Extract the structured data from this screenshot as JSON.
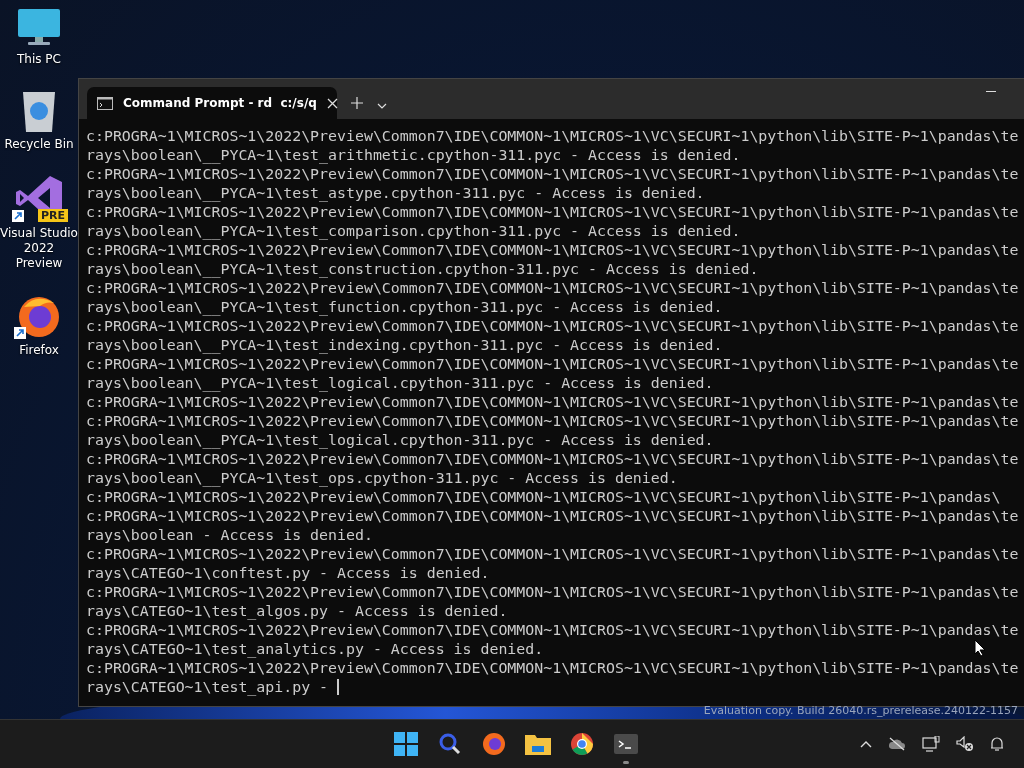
{
  "desktop_icons": [
    {
      "kind": "pc",
      "label": "This PC"
    },
    {
      "kind": "bin",
      "label": "Recycle Bin"
    },
    {
      "kind": "vs",
      "label": "Visual Studio 2022 Preview",
      "badge": "PRE",
      "shortcut": true
    },
    {
      "kind": "firefox",
      "label": "Firefox",
      "shortcut": true
    }
  ],
  "window": {
    "tabs": [
      {
        "title": "Command Prompt - rd  c:/s/q",
        "selected": true
      }
    ],
    "lines": [
      "c:PROGRA~1\\MICROS~1\\2022\\Preview\\Common7\\IDE\\COMMON~1\\MICROS~1\\VC\\SECURI~1\\python\\lib\\SITE-P~1\\pandas\\te",
      "rays\\boolean\\__PYCA~1\\test_arithmetic.cpython-311.pyc - Access is denied.",
      "c:PROGRA~1\\MICROS~1\\2022\\Preview\\Common7\\IDE\\COMMON~1\\MICROS~1\\VC\\SECURI~1\\python\\lib\\SITE-P~1\\pandas\\te",
      "rays\\boolean\\__PYCA~1\\test_astype.cpython-311.pyc - Access is denied.",
      "c:PROGRA~1\\MICROS~1\\2022\\Preview\\Common7\\IDE\\COMMON~1\\MICROS~1\\VC\\SECURI~1\\python\\lib\\SITE-P~1\\pandas\\te",
      "rays\\boolean\\__PYCA~1\\test_comparison.cpython-311.pyc - Access is denied.",
      "c:PROGRA~1\\MICROS~1\\2022\\Preview\\Common7\\IDE\\COMMON~1\\MICROS~1\\VC\\SECURI~1\\python\\lib\\SITE-P~1\\pandas\\te",
      "rays\\boolean\\__PYCA~1\\test_construction.cpython-311.pyc - Access is denied.",
      "c:PROGRA~1\\MICROS~1\\2022\\Preview\\Common7\\IDE\\COMMON~1\\MICROS~1\\VC\\SECURI~1\\python\\lib\\SITE-P~1\\pandas\\te",
      "rays\\boolean\\__PYCA~1\\test_function.cpython-311.pyc - Access is denied.",
      "c:PROGRA~1\\MICROS~1\\2022\\Preview\\Common7\\IDE\\COMMON~1\\MICROS~1\\VC\\SECURI~1\\python\\lib\\SITE-P~1\\pandas\\te",
      "rays\\boolean\\__PYCA~1\\test_indexing.cpython-311.pyc - Access is denied.",
      "c:PROGRA~1\\MICROS~1\\2022\\Preview\\Common7\\IDE\\COMMON~1\\MICROS~1\\VC\\SECURI~1\\python\\lib\\SITE-P~1\\pandas\\te",
      "rays\\boolean\\__PYCA~1\\test_logical.cpython-311.pyc - Access is denied.",
      "c:PROGRA~1\\MICROS~1\\2022\\Preview\\Common7\\IDE\\COMMON~1\\MICROS~1\\VC\\SECURI~1\\python\\lib\\SITE-P~1\\pandas\\te",
      "c:PROGRA~1\\MICROS~1\\2022\\Preview\\Common7\\IDE\\COMMON~1\\MICROS~1\\VC\\SECURI~1\\python\\lib\\SITE-P~1\\pandas\\te",
      "rays\\boolean\\__PYCA~1\\test_logical.cpython-311.pyc - Access is denied.",
      "c:PROGRA~1\\MICROS~1\\2022\\Preview\\Common7\\IDE\\COMMON~1\\MICROS~1\\VC\\SECURI~1\\python\\lib\\SITE-P~1\\pandas\\te",
      "rays\\boolean\\__PYCA~1\\test_ops.cpython-311.pyc - Access is denied.",
      "c:PROGRA~1\\MICROS~1\\2022\\Preview\\Common7\\IDE\\COMMON~1\\MICROS~1\\VC\\SECURI~1\\python\\lib\\SITE-P~1\\pandas\\",
      "c:PROGRA~1\\MICROS~1\\2022\\Preview\\Common7\\IDE\\COMMON~1\\MICROS~1\\VC\\SECURI~1\\python\\lib\\SITE-P~1\\pandas\\te",
      "rays\\boolean - Access is denied.",
      "c:PROGRA~1\\MICROS~1\\2022\\Preview\\Common7\\IDE\\COMMON~1\\MICROS~1\\VC\\SECURI~1\\python\\lib\\SITE-P~1\\pandas\\te",
      "rays\\CATEGO~1\\conftest.py - Access is denied.",
      "c:PROGRA~1\\MICROS~1\\2022\\Preview\\Common7\\IDE\\COMMON~1\\MICROS~1\\VC\\SECURI~1\\python\\lib\\SITE-P~1\\pandas\\te",
      "rays\\CATEGO~1\\test_algos.py - Access is denied.",
      "c:PROGRA~1\\MICROS~1\\2022\\Preview\\Common7\\IDE\\COMMON~1\\MICROS~1\\VC\\SECURI~1\\python\\lib\\SITE-P~1\\pandas\\te",
      "rays\\CATEGO~1\\test_analytics.py - Access is denied.",
      "c:PROGRA~1\\MICROS~1\\2022\\Preview\\Common7\\IDE\\COMMON~1\\MICROS~1\\VC\\SECURI~1\\python\\lib\\SITE-P~1\\pandas\\te",
      "rays\\CATEGO~1\\test_api.py -"
    ]
  },
  "watermark_text": "Evaluation copy. Build 26040.rs_prerelease.240122-1157",
  "taskbar": {
    "apps": [
      {
        "kind": "start",
        "active": false
      },
      {
        "kind": "search",
        "active": false
      },
      {
        "kind": "firefox",
        "active": false
      },
      {
        "kind": "explorer",
        "active": false
      },
      {
        "kind": "chrome",
        "active": false
      },
      {
        "kind": "terminal",
        "active": true
      }
    ],
    "tray": [
      {
        "kind": "chevron"
      },
      {
        "kind": "cloud-off"
      },
      {
        "kind": "network"
      },
      {
        "kind": "mute"
      },
      {
        "kind": "bell"
      }
    ]
  }
}
